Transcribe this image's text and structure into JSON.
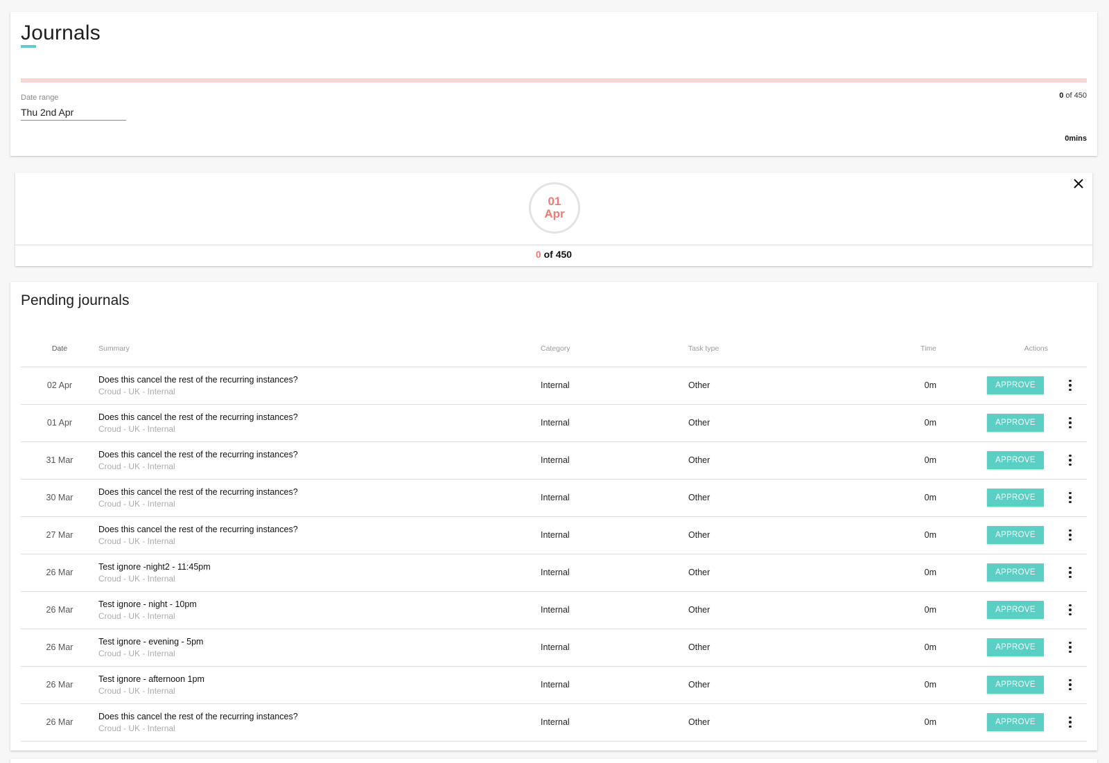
{
  "header": {
    "title": "Journals",
    "progress_fraction": 0,
    "date_range_label": "Date range",
    "date_range_value": "Thu 2nd Apr",
    "count_done": "0",
    "count_rest": " of 450",
    "mins": "0mins"
  },
  "day_summary": {
    "day": "01",
    "month": "Apr",
    "count_done": "0",
    "count_rest": " of 450"
  },
  "pending": {
    "title": "Pending journals",
    "columns": {
      "date": "Date",
      "summary": "Summary",
      "category": "Category",
      "task_type": "Task type",
      "time": "Time",
      "actions": "Actions"
    },
    "approve_label": "APPROVE",
    "rows": [
      {
        "date": "02 Apr",
        "title": "Does this cancel the rest of the recurring instances?",
        "sub": "Croud - UK - Internal",
        "category": "Internal",
        "task_type": "Other",
        "time": "0m"
      },
      {
        "date": "01 Apr",
        "title": "Does this cancel the rest of the recurring instances?",
        "sub": "Croud - UK - Internal",
        "category": "Internal",
        "task_type": "Other",
        "time": "0m"
      },
      {
        "date": "31 Mar",
        "title": "Does this cancel the rest of the recurring instances?",
        "sub": "Croud - UK - Internal",
        "category": "Internal",
        "task_type": "Other",
        "time": "0m"
      },
      {
        "date": "30 Mar",
        "title": "Does this cancel the rest of the recurring instances?",
        "sub": "Croud - UK - Internal",
        "category": "Internal",
        "task_type": "Other",
        "time": "0m"
      },
      {
        "date": "27 Mar",
        "title": "Does this cancel the rest of the recurring instances?",
        "sub": "Croud - UK - Internal",
        "category": "Internal",
        "task_type": "Other",
        "time": "0m"
      },
      {
        "date": "26 Mar",
        "title": "Test ignore -night2 - 11:45pm",
        "sub": "Croud - UK - Internal",
        "category": "Internal",
        "task_type": "Other",
        "time": "0m"
      },
      {
        "date": "26 Mar",
        "title": "Test ignore - night - 10pm",
        "sub": "Croud - UK - Internal",
        "category": "Internal",
        "task_type": "Other",
        "time": "0m"
      },
      {
        "date": "26 Mar",
        "title": "Test ignore - evening - 5pm",
        "sub": "Croud - UK - Internal",
        "category": "Internal",
        "task_type": "Other",
        "time": "0m"
      },
      {
        "date": "26 Mar",
        "title": "Test ignore - afternoon 1pm",
        "sub": "Croud - UK - Internal",
        "category": "Internal",
        "task_type": "Other",
        "time": "0m"
      },
      {
        "date": "26 Mar",
        "title": "Does this cancel the rest of the recurring instances?",
        "sub": "Croud - UK - Internal",
        "category": "Internal",
        "task_type": "Other",
        "time": "0m"
      }
    ]
  },
  "colors": {
    "accent": "#5ccfc4",
    "highlight": "#ef7a74",
    "progress_track": "#f9d6d3"
  },
  "icons": {
    "close": "close-icon",
    "more": "more-vert-icon"
  }
}
